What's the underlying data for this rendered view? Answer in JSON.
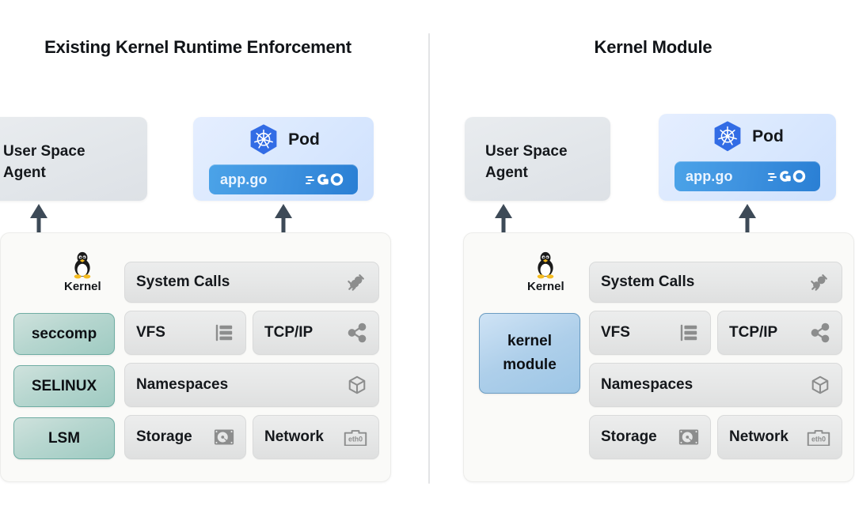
{
  "panels": [
    {
      "title": "Existing Kernel Runtime\nEnforcement",
      "agent": {
        "label": "User Space\nAgent"
      },
      "pod": {
        "label": "Pod",
        "logo": "kubernetes-icon",
        "container": {
          "name": "app.go",
          "logo": "golang-icon"
        }
      },
      "kernel": {
        "logo": "linux-tux-icon",
        "label": "Kernel",
        "security_chips": [
          {
            "label": "seccomp"
          },
          {
            "label": "SELINUX"
          },
          {
            "label": "LSM"
          }
        ],
        "subsystems": [
          {
            "label": "System Calls",
            "icon": "plug-icon"
          },
          {
            "label": "VFS",
            "icon": "file-tree-icon"
          },
          {
            "label": "TCP/IP",
            "icon": "share-nodes-icon"
          },
          {
            "label": "Namespaces",
            "icon": "cube-icon"
          },
          {
            "label": "Storage",
            "icon": "hard-disk-icon"
          },
          {
            "label": "Network",
            "icon": "eth0-nic-icon"
          }
        ]
      }
    },
    {
      "title": "Kernel Module",
      "agent": {
        "label": "User Space\nAgent"
      },
      "pod": {
        "label": "Pod",
        "logo": "kubernetes-icon",
        "container": {
          "name": "app.go",
          "logo": "golang-icon"
        }
      },
      "kernel": {
        "logo": "linux-tux-icon",
        "label": "Kernel",
        "module_chip": {
          "label": "kernel\nmodule"
        },
        "subsystems": [
          {
            "label": "System Calls",
            "icon": "plug-icon"
          },
          {
            "label": "VFS",
            "icon": "file-tree-icon"
          },
          {
            "label": "TCP/IP",
            "icon": "share-nodes-icon"
          },
          {
            "label": "Namespaces",
            "icon": "cube-icon"
          },
          {
            "label": "Storage",
            "icon": "hard-disk-icon"
          },
          {
            "label": "Network",
            "icon": "eth0-nic-icon"
          }
        ]
      }
    }
  ],
  "colors": {
    "background": "#ffffff",
    "title_text": "#111418",
    "divider": "#e3e4e6",
    "agent_box": "#e4e8ec",
    "pod_box": "#dbe9fe",
    "appgo_bar": "#3f93e0",
    "kernel_panel": "#fafaf8",
    "chip": "#e6e7e7",
    "chip_green": "#b6d6cf",
    "chip_green_border": "#6fada3",
    "chip_blue": "#aecfea",
    "chip_blue_border": "#6b9cc2",
    "arrow": "#3d4a57",
    "icon_grey": "#8c8d8d",
    "k8s_blue": "#326ce5",
    "tux_yellow": "#f5bc21"
  }
}
